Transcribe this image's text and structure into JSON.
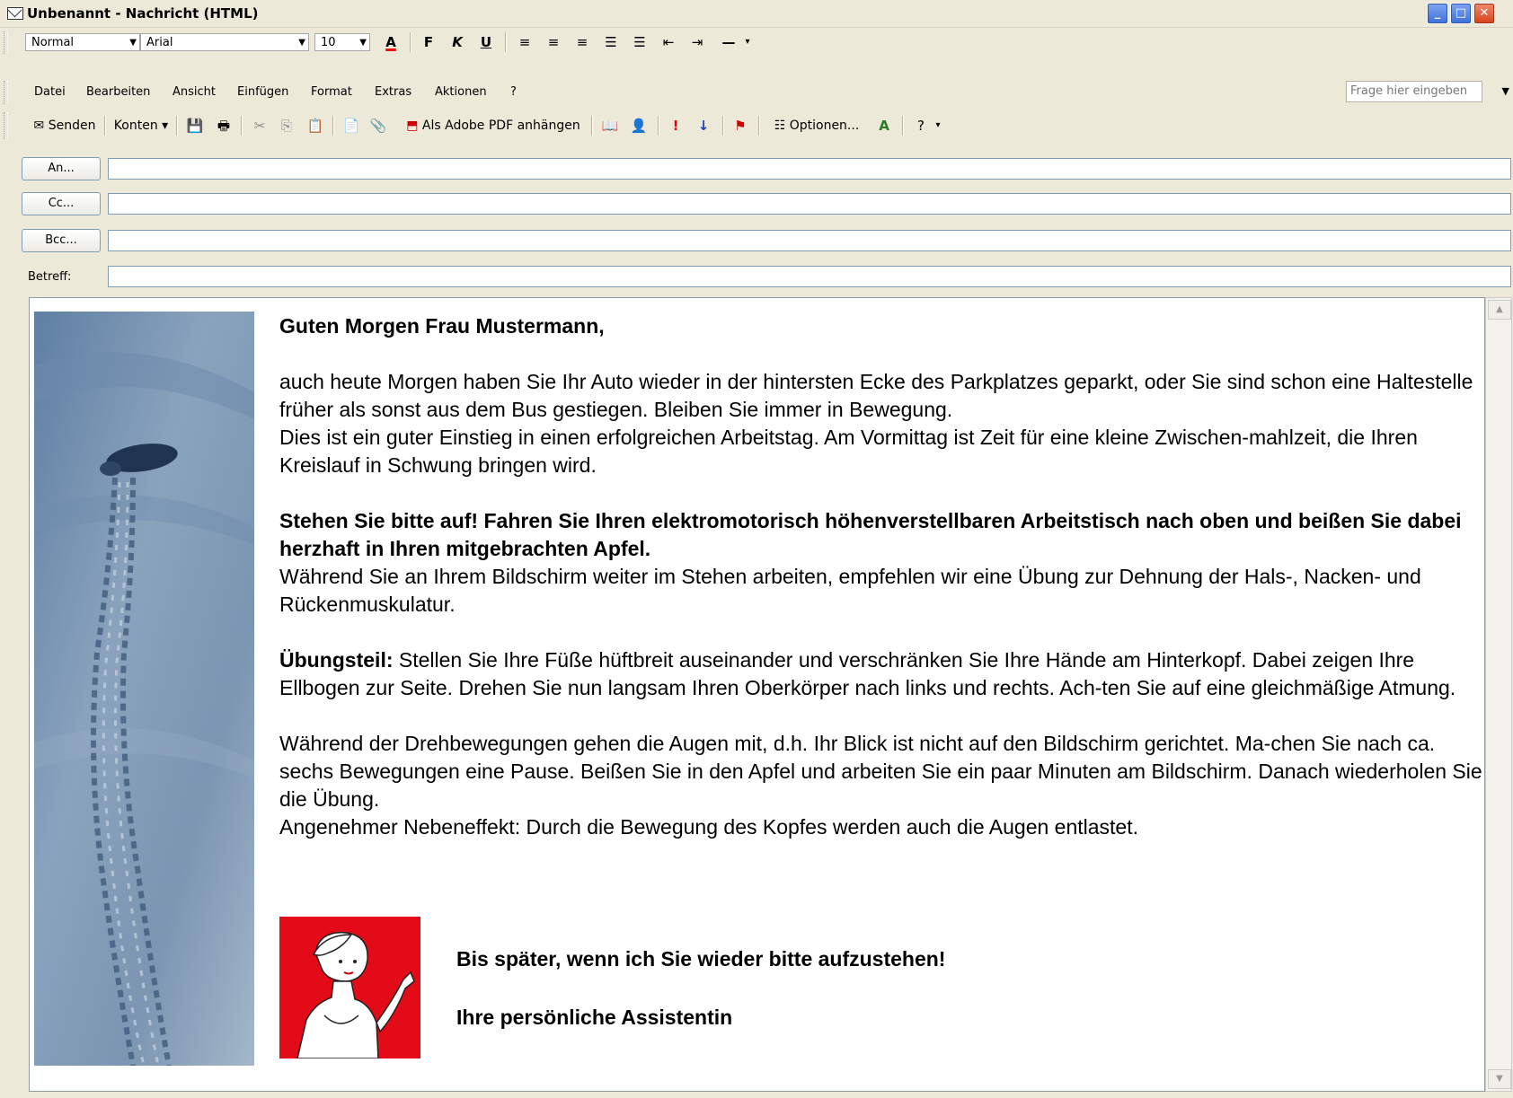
{
  "window": {
    "title": "Unbenannt - Nachricht (HTML)"
  },
  "format_toolbar": {
    "style": "Normal",
    "font": "Arial",
    "size": "10",
    "bold_label": "F",
    "italic_label": "K",
    "underline_label": "U"
  },
  "menu": {
    "items": [
      {
        "label": "Datei"
      },
      {
        "label": "Bearbeiten"
      },
      {
        "label": "Ansicht"
      },
      {
        "label": "Einfügen"
      },
      {
        "label": "Format"
      },
      {
        "label": "Extras"
      },
      {
        "label": "Aktionen"
      },
      {
        "label": "?"
      }
    ],
    "question_placeholder": "Frage hier eingeben"
  },
  "std_toolbar": {
    "send": "Senden",
    "accounts": "Konten",
    "pdf": "Als Adobe PDF anhängen",
    "options": "Optionen..."
  },
  "header": {
    "to_button": "An...",
    "cc_button": "Cc...",
    "bcc_button": "Bcc...",
    "subject_label": "Betreff:",
    "to_value": "",
    "cc_value": "",
    "bcc_value": "",
    "subject_value": ""
  },
  "message": {
    "greeting": "Guten Morgen Frau Mustermann,",
    "para1": "auch heute Morgen haben Sie Ihr Auto wieder in der hintersten Ecke des Parkplatzes geparkt, oder Sie sind schon eine Haltestelle früher als sonst aus dem Bus gestiegen. Bleiben Sie immer in Bewegung.",
    "para2": "Dies ist ein guter Einstieg in einen erfolgreichen Arbeitstag. Am Vormittag ist Zeit für eine kleine Zwischen-mahlzeit, die Ihren Kreislauf in Schwung bringen wird.",
    "bold_instruction": "Stehen Sie bitte auf! Fahren Sie Ihren elektromotorisch höhenverstellbaren Arbeitstisch nach oben und beißen Sie dabei herzhaft in Ihren mitgebrachten Apfel.",
    "para3": "Während Sie an Ihrem Bildschirm weiter im Stehen arbeiten, empfehlen wir eine Übung zur Dehnung der Hals-, Nacken- und Rückenmuskulatur.",
    "exercise_label": "Übungsteil:",
    "exercise_text": " Stellen Sie Ihre Füße hüftbreit auseinander und verschränken Sie Ihre Hände am Hinterkopf. Dabei zeigen Ihre Ellbogen zur Seite. Drehen Sie nun langsam Ihren Oberkörper nach links und rechts. Ach-ten Sie auf eine gleichmäßige Atmung.",
    "para4": "Während der Drehbewegungen gehen die Augen mit, d.h. Ihr Blick ist nicht auf den Bildschirm gerichtet. Ma-chen Sie nach ca. sechs Bewegungen eine Pause. Beißen Sie in den Apfel und arbeiten Sie ein paar Minuten am Bildschirm. Danach wiederholen Sie die Übung.",
    "para5": "Angenehmer Nebeneffekt: Durch die Bewegung des Kopfes werden auch die Augen entlastet.",
    "closing1": "Bis später, wenn ich Sie wieder bitte aufzustehen!",
    "closing2": "Ihre persönliche Assistentin"
  }
}
